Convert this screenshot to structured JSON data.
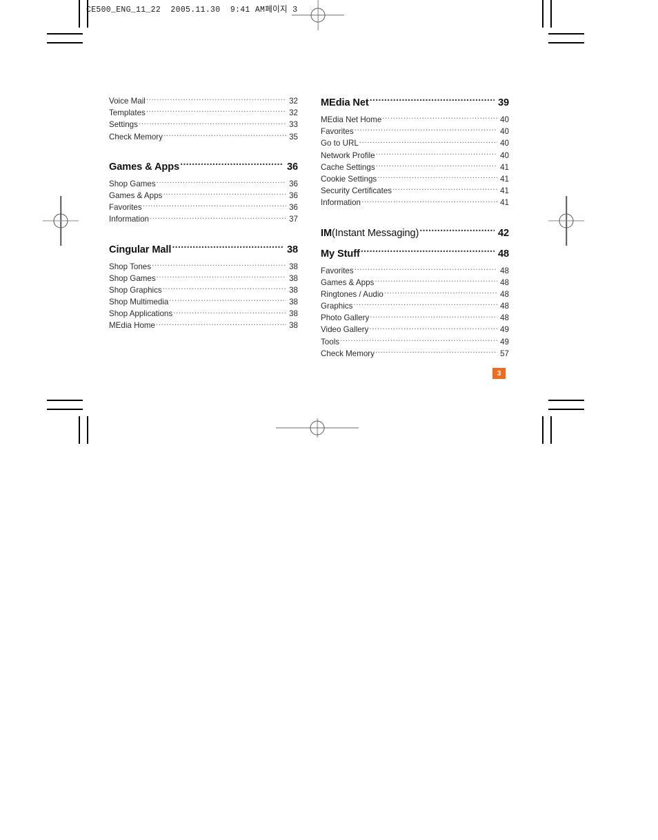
{
  "document": {
    "slug": "CE500_ENG_11_22  2005.11.30  9:41 AM페이지 3",
    "page_badge": "3",
    "accent_color": "#ef6c1f",
    "text_color": "#231f20"
  },
  "toc": {
    "left_column": [
      {
        "type": "sub",
        "label": "Voice Mail",
        "page": "32"
      },
      {
        "type": "sub",
        "label": "Templates",
        "page": "32"
      },
      {
        "type": "sub",
        "label": "Settings",
        "page": "33"
      },
      {
        "type": "sub",
        "label": "Check Memory",
        "page": "35"
      },
      {
        "type": "head",
        "label": "Games & Apps",
        "page": "36"
      },
      {
        "type": "sub",
        "label": "Shop Games",
        "page": "36"
      },
      {
        "type": "sub",
        "label": "Games & Apps",
        "page": "36"
      },
      {
        "type": "sub",
        "label": "Favorites",
        "page": "36"
      },
      {
        "type": "sub",
        "label": "Information",
        "page": "37"
      },
      {
        "type": "head",
        "label": "Cingular Mall",
        "page": "38"
      },
      {
        "type": "sub",
        "label": "Shop Tones",
        "page": "38"
      },
      {
        "type": "sub",
        "label": "Shop Games",
        "page": "38"
      },
      {
        "type": "sub",
        "label": "Shop Graphics",
        "page": "38"
      },
      {
        "type": "sub",
        "label": "Shop Multimedia",
        "page": "38"
      },
      {
        "type": "sub",
        "label": "Shop Applications",
        "page": "38"
      },
      {
        "type": "sub",
        "label": "MEdia Home",
        "page": "38"
      }
    ],
    "right_column": [
      {
        "type": "head",
        "label": "MEdia Net",
        "page": "39"
      },
      {
        "type": "sub",
        "label": "MEdia Net Home",
        "page": "40"
      },
      {
        "type": "sub",
        "label": "Favorites",
        "page": "40"
      },
      {
        "type": "sub",
        "label": "Go to URL",
        "page": "40"
      },
      {
        "type": "sub",
        "label": "Network Profile",
        "page": "40"
      },
      {
        "type": "sub",
        "label": "Cache Settings",
        "page": "41"
      },
      {
        "type": "sub",
        "label": "Cookie Settings",
        "page": "41"
      },
      {
        "type": "sub",
        "label": "Security Certificates",
        "page": "41"
      },
      {
        "type": "sub",
        "label": "Information",
        "page": "41"
      },
      {
        "type": "head",
        "label": "IM",
        "label_soft": "(Instant Messaging)",
        "page": "42"
      },
      {
        "type": "head",
        "label": "My Stuff",
        "page": "48"
      },
      {
        "type": "sub",
        "label": "Favorites",
        "page": "48"
      },
      {
        "type": "sub",
        "label": "Games & Apps",
        "page": "48"
      },
      {
        "type": "sub",
        "label": "Ringtones / Audio",
        "page": "48"
      },
      {
        "type": "sub",
        "label": "Graphics",
        "page": "48"
      },
      {
        "type": "sub",
        "label": "Photo Gallery",
        "page": "48"
      },
      {
        "type": "sub",
        "label": "Video Gallery",
        "page": "49"
      },
      {
        "type": "sub",
        "label": "Tools",
        "page": "49"
      },
      {
        "type": "sub",
        "label": "Check Memory",
        "page": "57"
      }
    ]
  }
}
